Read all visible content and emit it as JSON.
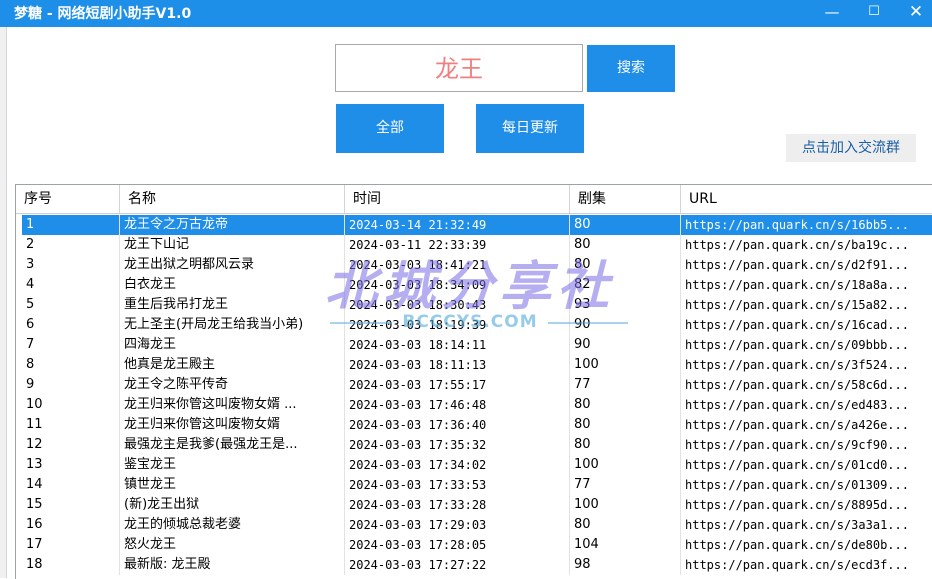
{
  "window": {
    "title": "梦糖 - 网络短剧小助手V1.0",
    "minimize": "—",
    "maximize": "☐",
    "close": "✕"
  },
  "search": {
    "value": "龙王",
    "button": "搜索"
  },
  "actions": {
    "all": "全部",
    "daily": "每日更新",
    "join": "点击加入交流群"
  },
  "table": {
    "headers": [
      "序号",
      "名称",
      "时间",
      "剧集",
      "URL"
    ],
    "rows": [
      [
        "1",
        "龙王令之万古龙帝",
        "2024-03-14 21:32:49",
        "80",
        "https://pan.quark.cn/s/16bb5..."
      ],
      [
        "2",
        "龙王下山记",
        "2024-03-11 22:33:39",
        "80",
        "https://pan.quark.cn/s/ba19c..."
      ],
      [
        "3",
        "龙王出狱之明都风云录",
        "2024-03-03 18:41:21",
        "80",
        "https://pan.quark.cn/s/d2f91..."
      ],
      [
        "4",
        "白衣龙王",
        "2024-03-03 18:34:09",
        "82",
        "https://pan.quark.cn/s/18a8a..."
      ],
      [
        "5",
        "重生后我吊打龙王",
        "2024-03-03 18:30:43",
        "93",
        "https://pan.quark.cn/s/15a82..."
      ],
      [
        "6",
        "无上圣主(开局龙王给我当小弟)",
        "2024-03-03 18:19:39",
        "90",
        "https://pan.quark.cn/s/16cad..."
      ],
      [
        "7",
        "四海龙王",
        "2024-03-03 18:14:11",
        "90",
        "https://pan.quark.cn/s/09bbb..."
      ],
      [
        "8",
        "他真是龙王殿主",
        "2024-03-03 18:11:13",
        "100",
        "https://pan.quark.cn/s/3f524..."
      ],
      [
        "9",
        "龙王令之陈平传奇",
        "2024-03-03 17:55:17",
        "77",
        "https://pan.quark.cn/s/58c6d..."
      ],
      [
        "10",
        "龙王归来你管这叫废物女婿 ...",
        "2024-03-03 17:46:48",
        "80",
        "https://pan.quark.cn/s/ed483..."
      ],
      [
        "11",
        "龙王归来你管这叫废物女婿",
        "2024-03-03 17:36:40",
        "80",
        "https://pan.quark.cn/s/a426e..."
      ],
      [
        "12",
        "最强龙主是我爹(最强龙王是...",
        "2024-03-03 17:35:32",
        "80",
        "https://pan.quark.cn/s/9cf90..."
      ],
      [
        "13",
        "鉴宝龙王",
        "2024-03-03 17:34:02",
        "100",
        "https://pan.quark.cn/s/01cd0..."
      ],
      [
        "14",
        "镇世龙王",
        "2024-03-03 17:33:53",
        "77",
        "https://pan.quark.cn/s/01309..."
      ],
      [
        "15",
        "(新)龙王出狱",
        "2024-03-03 17:33:28",
        "100",
        "https://pan.quark.cn/s/8895d..."
      ],
      [
        "16",
        "龙王的倾城总裁老婆",
        "2024-03-03 17:29:03",
        "80",
        "https://pan.quark.cn/s/3a3a1..."
      ],
      [
        "17",
        "怒火龙王",
        "2024-03-03 17:28:05",
        "104",
        "https://pan.quark.cn/s/de80b..."
      ],
      [
        "18",
        "最新版: 龙王殿",
        "2024-03-03 17:27:22",
        "98",
        "https://pan.quark.cn/s/ecd3f..."
      ]
    ]
  },
  "watermark": {
    "main": "北城分享社",
    "sub": "BCCCYS.COM"
  }
}
